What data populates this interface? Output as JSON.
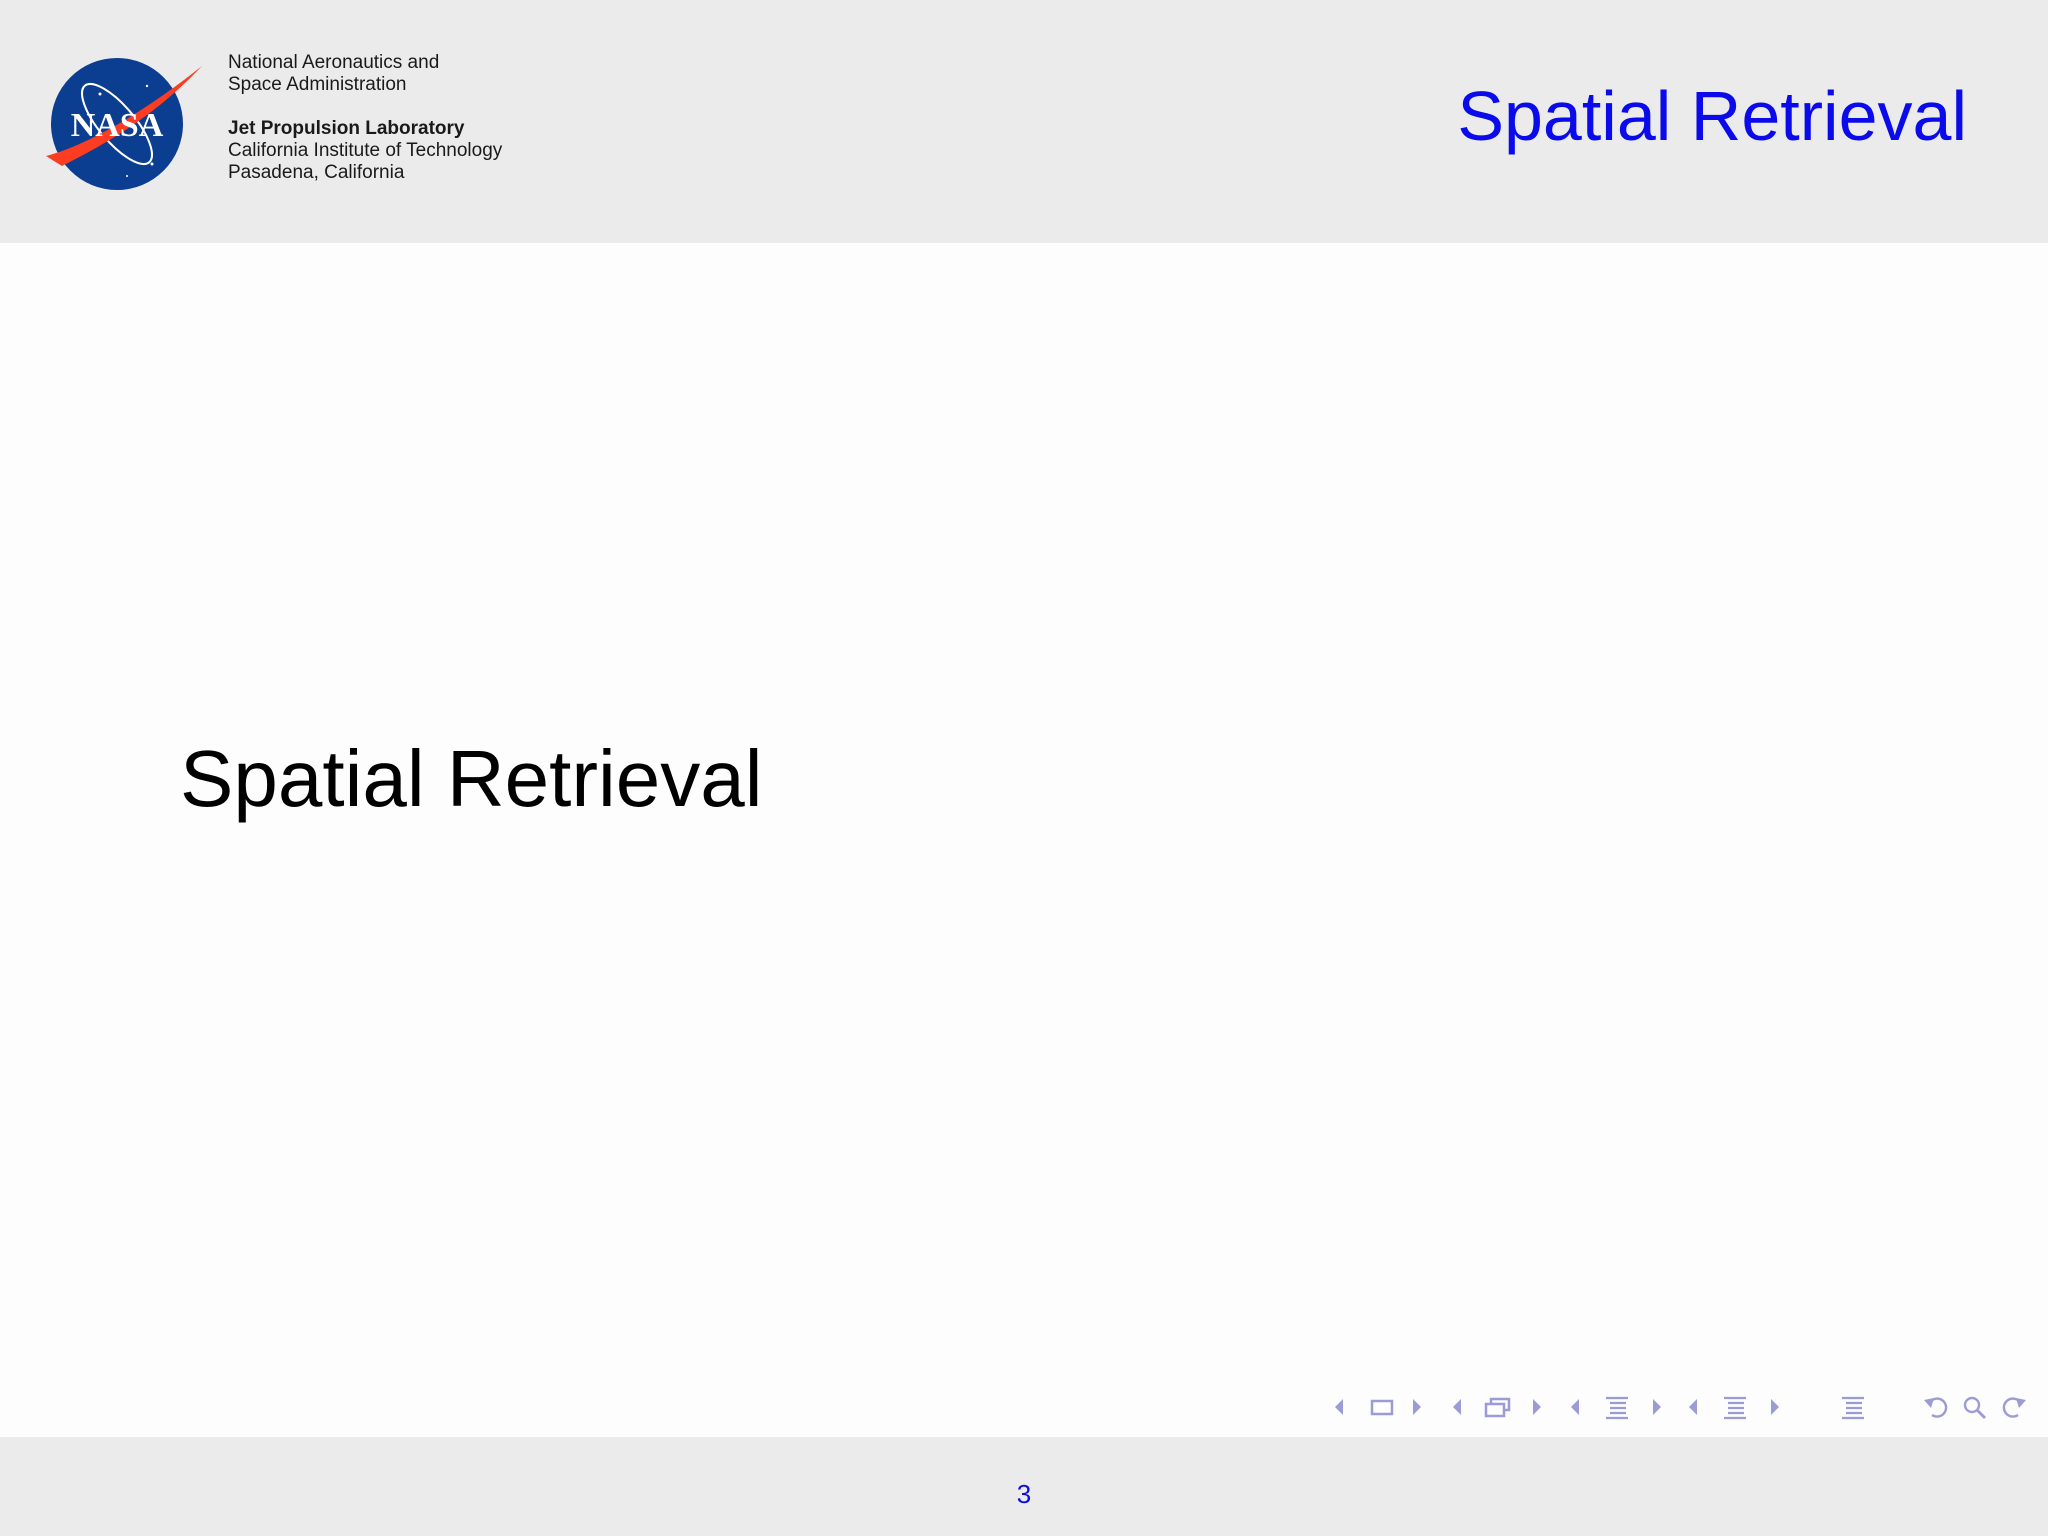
{
  "colors": {
    "accent": "#0a0aeb",
    "header_bg": "#ebebec",
    "nav_icon": "#9b9bd6"
  },
  "header": {
    "logo_icon": "nasa-meatball-logo",
    "org_lines": [
      "National Aeronautics and",
      "Space Administration"
    ],
    "lab_name": "Jet Propulsion Laboratory",
    "lab_lines": [
      "California Institute of Technology",
      "Pasadena, California"
    ],
    "title": "Spatial Retrieval"
  },
  "main": {
    "section_title": "Spatial Retrieval"
  },
  "navigation": {
    "icons": [
      "arrow-left-icon",
      "frame-icon",
      "arrow-right-icon",
      "arrow-left-icon",
      "subsection-icon",
      "arrow-right-icon",
      "arrow-left-icon",
      "section-icon",
      "arrow-right-icon",
      "arrow-left-icon",
      "document-icon",
      "arrow-right-icon",
      "toc-icon",
      "back-icon",
      "search-icon",
      "forward-icon"
    ]
  },
  "footer": {
    "page_number": "3"
  }
}
